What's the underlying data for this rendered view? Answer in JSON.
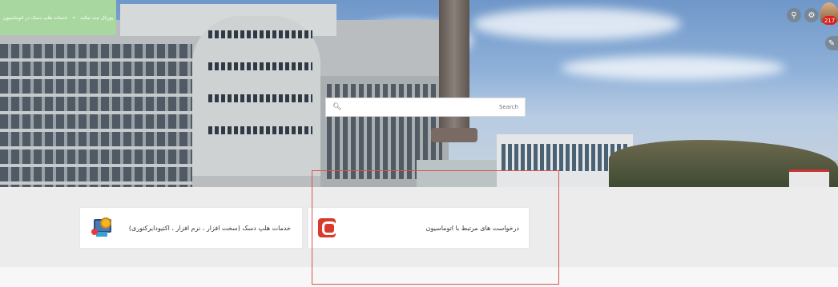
{
  "breadcrumb": {
    "items": [
      "پورتال ثبت تیکت",
      "خدمات هلپ دسک در اتوماسیون"
    ],
    "separator": "»"
  },
  "search": {
    "placeholder": "Search",
    "icon": "search-icon"
  },
  "header": {
    "notification_count": "217",
    "icons": [
      "search-icon",
      "settings-icon",
      "user-avatar",
      "edit-icon"
    ]
  },
  "services": [
    {
      "title": "خدمات هلپ دسک (سخت افزار ، نرم افزار ، اکتیودایرکتوری)",
      "icon": "helpdesk-icon"
    },
    {
      "title": "درخواست های مرتبط با اتوماسیون",
      "icon": "automation-logo-icon"
    }
  ],
  "colors": {
    "breadcrumb_bg": "#a8d8a0",
    "highlight": "#d9534f",
    "badge": "#d9221d"
  }
}
